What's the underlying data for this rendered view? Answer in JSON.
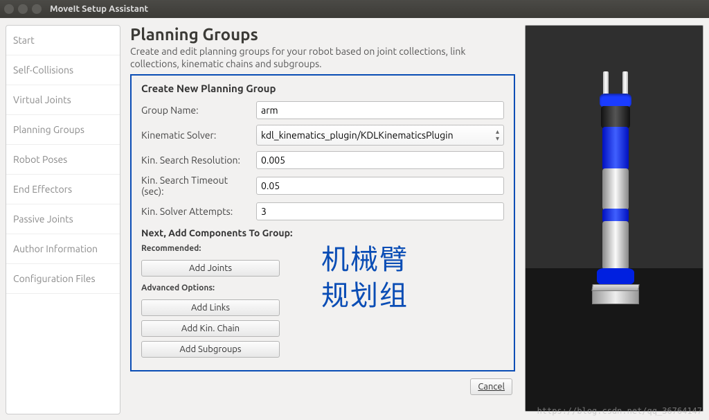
{
  "window": {
    "title": "MoveIt Setup Assistant"
  },
  "sidebar": {
    "items": [
      {
        "label": "Start"
      },
      {
        "label": "Self-Collisions"
      },
      {
        "label": "Virtual Joints"
      },
      {
        "label": "Planning Groups"
      },
      {
        "label": "Robot Poses"
      },
      {
        "label": "End Effectors"
      },
      {
        "label": "Passive Joints"
      },
      {
        "label": "Author Information"
      },
      {
        "label": "Configuration Files"
      }
    ]
  },
  "main": {
    "heading": "Planning Groups",
    "subtitle": "Create and edit planning groups for your robot based on joint collections, link collections, kinematic chains and subgroups.",
    "form_title": "Create New Planning Group",
    "labels": {
      "group_name": "Group Name:",
      "solver": "Kinematic Solver:",
      "resolution": "Kin. Search Resolution:",
      "timeout": "Kin. Search Timeout (sec):",
      "attempts": "Kin. Solver Attempts:"
    },
    "values": {
      "group_name": "arm",
      "solver": "kdl_kinematics_plugin/KDLKinematicsPlugin",
      "resolution": "0.005",
      "timeout": "0.05",
      "attempts": "3"
    },
    "components": {
      "title": "Next, Add Components To Group:",
      "rec_hdr": "Recommended:",
      "adv_hdr": "Advanced Options:",
      "add_joints": "Add Joints",
      "add_links": "Add Links",
      "add_chain": "Add Kin. Chain",
      "add_subgroups": "Add Subgroups"
    },
    "annotation": "机械臂\n规划组",
    "cancel": "Cancel"
  },
  "watermark": "https://blog.csdn.net/qq_36764147"
}
